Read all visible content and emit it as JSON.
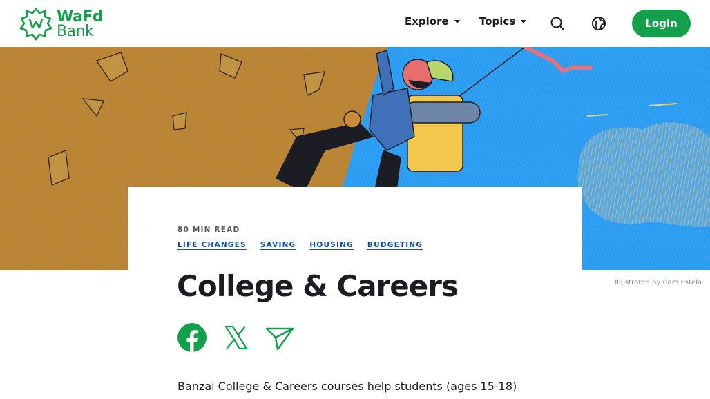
{
  "brand": {
    "line1": "WaFd",
    "line2": "Bank",
    "color": "#12a04a"
  },
  "nav": {
    "explore_label": "Explore",
    "topics_label": "Topics",
    "search_icon": "search-icon",
    "globe_icon": "globe-icon",
    "login_label": "Login"
  },
  "hero": {
    "credit": "Illustrated by Cam Estela"
  },
  "article": {
    "read_time": "80 MIN READ",
    "tags": [
      "LIFE CHANGES",
      "SAVING",
      "HOUSING",
      "BUDGETING"
    ],
    "title": "College & Careers",
    "intro": "Banzai College & Careers courses help students (ages 15-18)"
  },
  "share": {
    "facebook_icon": "facebook-icon",
    "x_icon": "x-icon",
    "send_icon": "send-icon"
  },
  "colors": {
    "accent": "#12a04a",
    "tag_link": "#0e4fa0",
    "text": "#1c1c24",
    "sky": "#2a9cf2",
    "ochre": "#b58a2e"
  }
}
